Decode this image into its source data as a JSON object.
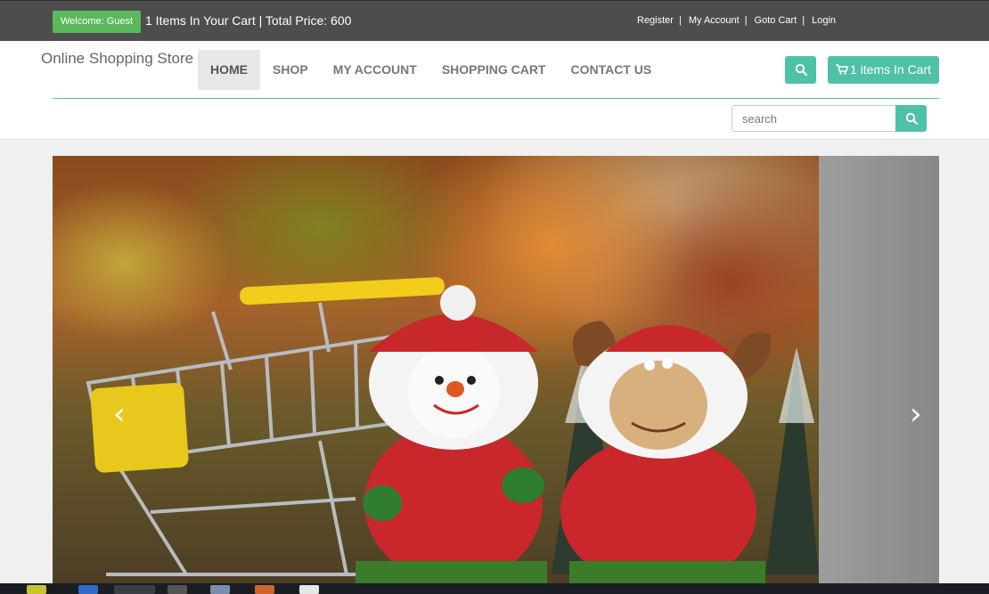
{
  "topbar": {
    "welcome": "Welcome: Guest",
    "cart_summary": "1 Items In Your Cart | Total Price: 600",
    "links": [
      "Register",
      "My Account",
      "Goto Cart",
      "Login"
    ]
  },
  "header": {
    "brand": "Online Shopping Store",
    "nav": [
      "HOME",
      "SHOP",
      "MY ACCOUNT",
      "SHOPPING CART",
      "CONTACT US"
    ],
    "cart_button": "1 items In Cart",
    "search_placeholder": "search"
  },
  "carousel": {
    "prev": "‹",
    "next": "›"
  },
  "colors": {
    "accent": "#4fc1a6",
    "welcome": "#5cb85c",
    "topbar": "#4d4d4d"
  },
  "icons": [
    "search-icon",
    "cart-icon",
    "chevron-left-icon",
    "chevron-right-icon"
  ]
}
